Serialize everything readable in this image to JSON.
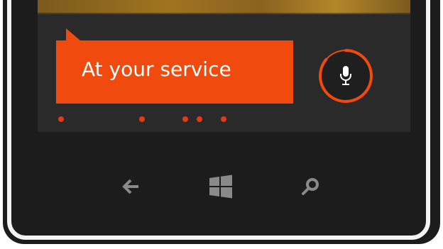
{
  "cortana": {
    "greeting": "At your service"
  },
  "icons": {
    "mic": "microphone-icon",
    "back": "back-arrow-icon",
    "start": "windows-logo-icon",
    "search": "search-icon"
  },
  "colors": {
    "accent": "#f04a0e",
    "dot": "#e23a16",
    "nav_icon": "#8a8a8a",
    "screen_bg": "#2a2a2a",
    "body_bg": "#1c1c1c"
  }
}
